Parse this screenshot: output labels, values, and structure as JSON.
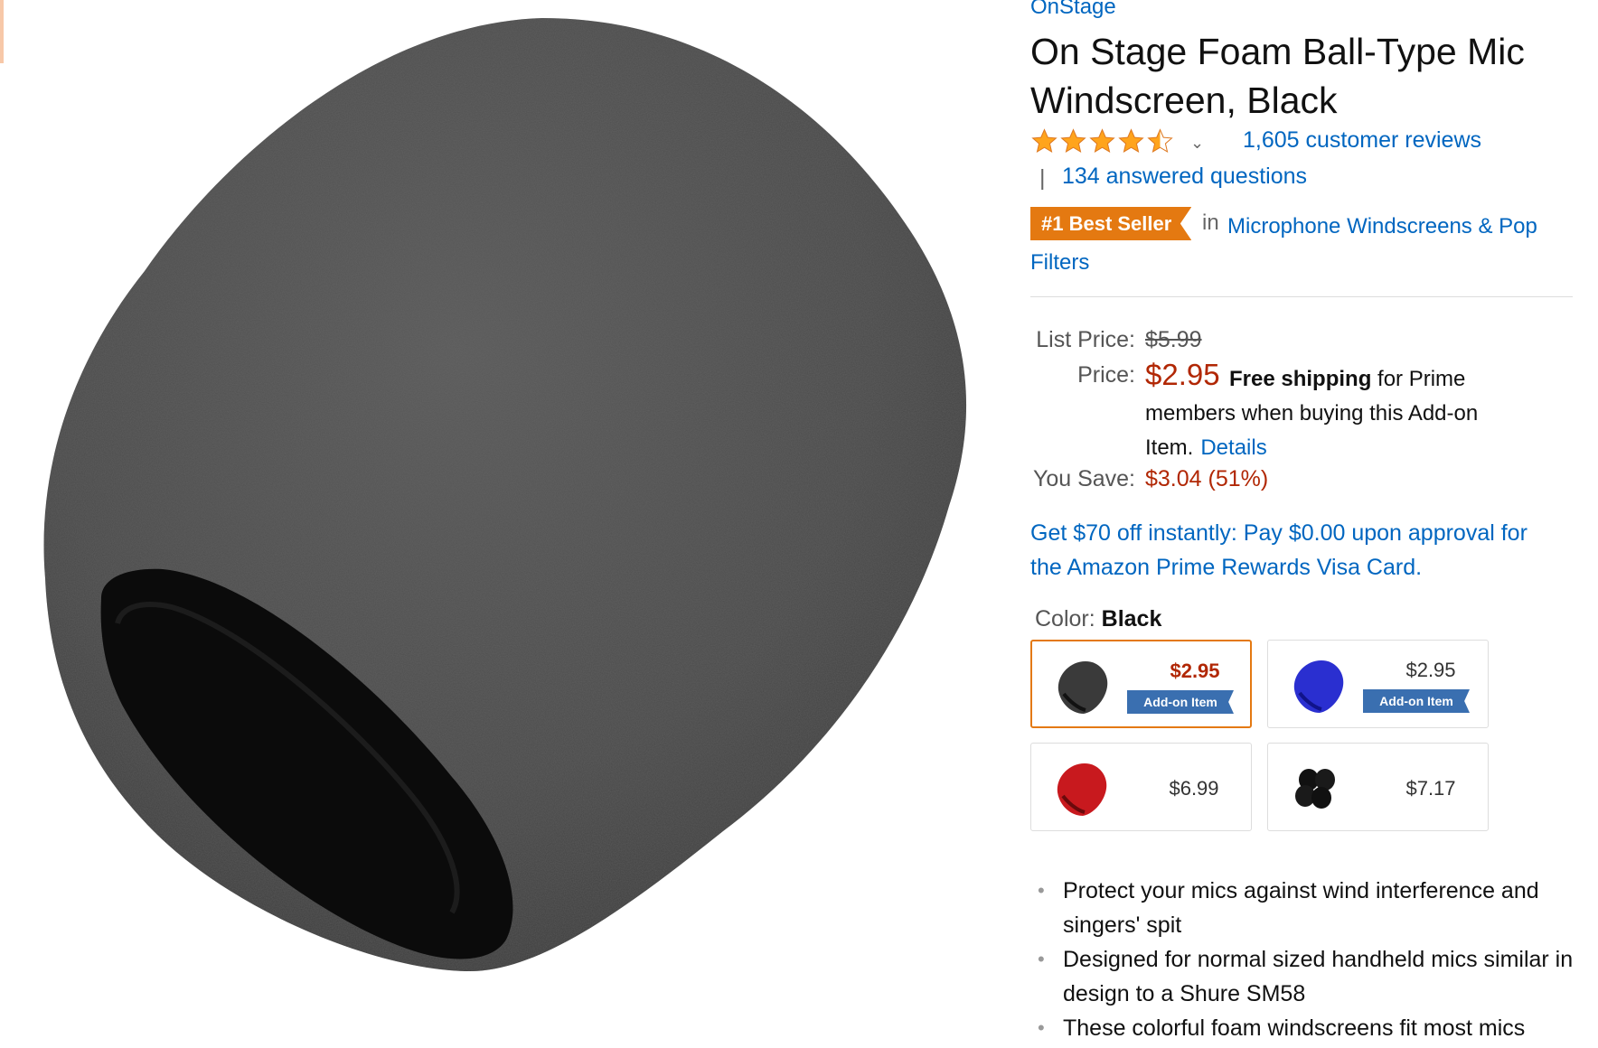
{
  "product": {
    "brand": "OnStage",
    "title": "On Stage Foam Ball-Type Mic Windscreen, Black",
    "rating": 4.5,
    "rating_max": 5,
    "reviews_label": "1,605 customer reviews",
    "separator": "|",
    "questions_label": "134 answered questions",
    "badge": "#1 Best Seller",
    "badge_in": "in",
    "category": "Microphone Windscreens & Pop Filters"
  },
  "pricing": {
    "list_price_label": "List Price:",
    "list_price": "$5.99",
    "price_label": "Price:",
    "price": "$2.95",
    "free_shipping": "Free shipping",
    "shipping_text": "for Prime members when buying this Add-on Item.",
    "details_link": "Details",
    "you_save_label": "You Save:",
    "you_save": "$3.04 (51%)",
    "promo": "Get $70 off instantly: Pay $0.00 upon approval for the Amazon Prime Rewards Visa Card."
  },
  "color": {
    "label": "Color:",
    "selected": "Black",
    "options": [
      {
        "name": "black",
        "price": "$2.95",
        "addon": "Add-on Item",
        "fill": "#3a3a3a"
      },
      {
        "name": "blue",
        "price": "$2.95",
        "addon": "Add-on Item",
        "fill": "#2a2fd0"
      },
      {
        "name": "red",
        "price": "$6.99",
        "fill": "#c8191e"
      },
      {
        "name": "black-multipack",
        "price": "$7.17",
        "fill": "#111111"
      }
    ]
  },
  "bullets": [
    "Protect your mics against wind interference and singers' spit",
    "Designed for normal sized handheld mics similar in design to a Shure SM58",
    "These colorful foam windscreens fit most mics"
  ],
  "colors": {
    "link": "#0066c0",
    "price_red": "#b12704",
    "badge_orange": "#e47911",
    "addon_blue": "#3a6fb0"
  }
}
